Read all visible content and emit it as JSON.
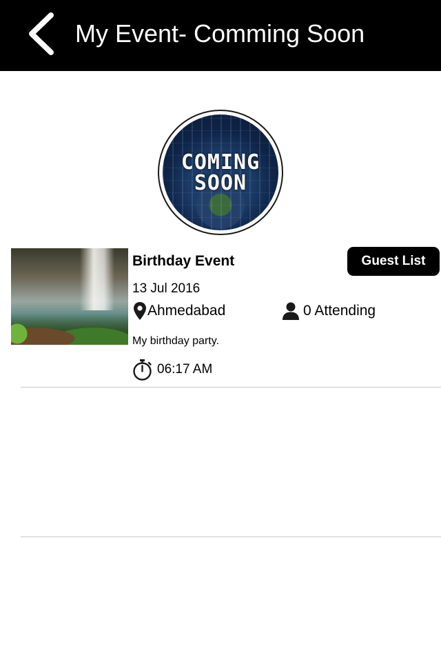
{
  "header": {
    "title": "My Event- Comming Soon",
    "background": "#000000",
    "back_icon": "chevron-left-icon"
  },
  "badge": {
    "line1": "COMING",
    "line2": "SOON"
  },
  "events": [
    {
      "title": "Birthday Event",
      "guest_list_label": "Guest List",
      "date": "13 Jul 2016",
      "location": "Ahmedabad",
      "location_icon": "map-pin-icon",
      "attending": "0 Attending",
      "attending_icon": "user-icon",
      "description": "My birthday party.",
      "time": "06:17 AM",
      "time_icon": "stopwatch-icon"
    }
  ]
}
